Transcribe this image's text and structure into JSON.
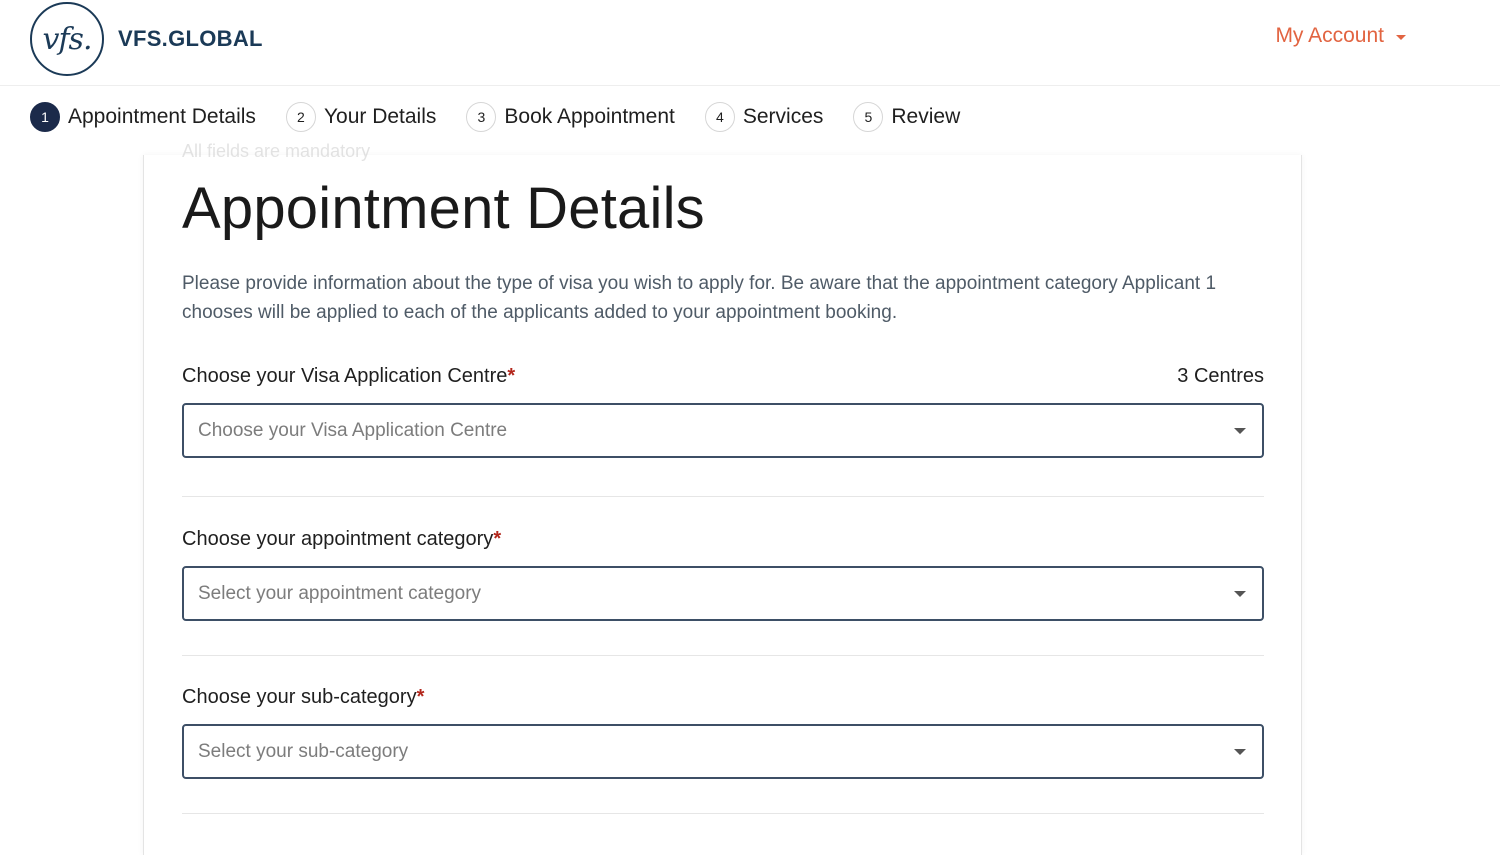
{
  "header": {
    "logo_mark": "vfs.",
    "logo_text": "VFS.GLOBAL",
    "account_label": "My Account",
    "accent_color": "#e26441",
    "brand_color": "#1b3a57"
  },
  "steps": [
    {
      "num": "1",
      "label": "Appointment Details",
      "active": true
    },
    {
      "num": "2",
      "label": "Your Details",
      "active": false
    },
    {
      "num": "3",
      "label": "Book Appointment",
      "active": false
    },
    {
      "num": "4",
      "label": "Services",
      "active": false
    },
    {
      "num": "5",
      "label": "Review",
      "active": false
    }
  ],
  "card": {
    "faded_note": "All fields are mandatory",
    "title": "Appointment Details",
    "description": "Please provide information about the type of visa you wish to apply for. Be aware that the appointment category Applicant 1 chooses will be applied to each of the applicants added to your appointment booking.",
    "fields": [
      {
        "label": "Choose your Visa Application Centre",
        "required_mark": "*",
        "count": "3 Centres",
        "placeholder": "Choose your Visa Application Centre"
      },
      {
        "label": "Choose your appointment category",
        "required_mark": "*",
        "placeholder": "Select your appointment category"
      },
      {
        "label": "Choose your sub-category",
        "required_mark": "*",
        "placeholder": "Select your sub-category"
      }
    ]
  }
}
